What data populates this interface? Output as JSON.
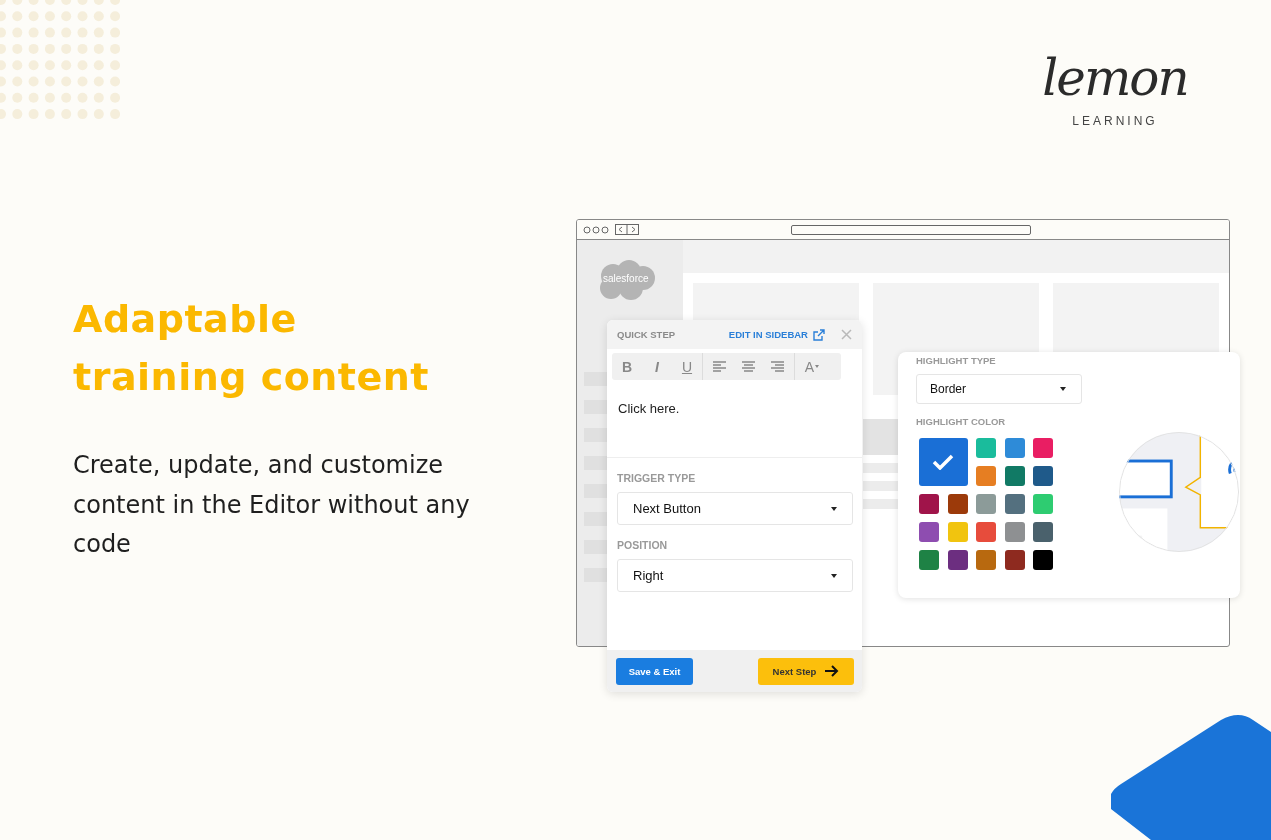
{
  "logo": {
    "wordmark": "lemon",
    "tagline": "LEARNING"
  },
  "heading": "Adaptable training content",
  "description": "Create, update, and customize content in the Editor without any code",
  "browser": {
    "app_logo": "salesforce"
  },
  "quick_step": {
    "title": "QUICK STEP",
    "link": "EDIT IN SIDEBAR",
    "format_buttons": [
      "B",
      "I",
      "U"
    ],
    "font_button": "A",
    "body_text": "Click here.",
    "fields": [
      {
        "label": "TRIGGER TYPE",
        "value": "Next Button"
      },
      {
        "label": "POSITION",
        "value": "Right"
      }
    ],
    "save_button": "Save & Exit",
    "next_button": "Next Step"
  },
  "highlight": {
    "type_label": "HIGHLIGHT TYPE",
    "type_value": "Border",
    "color_label": "HIGHLIGHT COLOR",
    "swatches": [
      {
        "color": "#1a6fd6",
        "selected": true
      },
      {
        "color": "#1abc9c",
        "selected": false
      },
      {
        "color": "#2e8bd8",
        "selected": false
      },
      {
        "color": "#e91e63",
        "selected": false
      },
      {
        "color": "#e67e22",
        "selected": false
      },
      {
        "color": "#117a65",
        "selected": false
      },
      {
        "color": "#1f5a8a",
        "selected": false
      },
      {
        "color": "#a0144a",
        "selected": false
      },
      {
        "color": "#9c3a0a",
        "selected": false
      },
      {
        "color": "#8c9b99",
        "selected": false
      },
      {
        "color": "#54707f",
        "selected": false
      },
      {
        "color": "#2ecc71",
        "selected": false
      },
      {
        "color": "#8e4db0",
        "selected": false
      },
      {
        "color": "#f1c40f",
        "selected": false
      },
      {
        "color": "#e74c3c",
        "selected": false
      },
      {
        "color": "#8e9092",
        "selected": false
      },
      {
        "color": "#4a616c",
        "selected": false
      },
      {
        "color": "#1e8245",
        "selected": false
      },
      {
        "color": "#6c2e80",
        "selected": false
      },
      {
        "color": "#b8690f",
        "selected": false
      },
      {
        "color": "#8e2a1f",
        "selected": false
      },
      {
        "color": "#000000",
        "selected": false
      }
    ]
  }
}
